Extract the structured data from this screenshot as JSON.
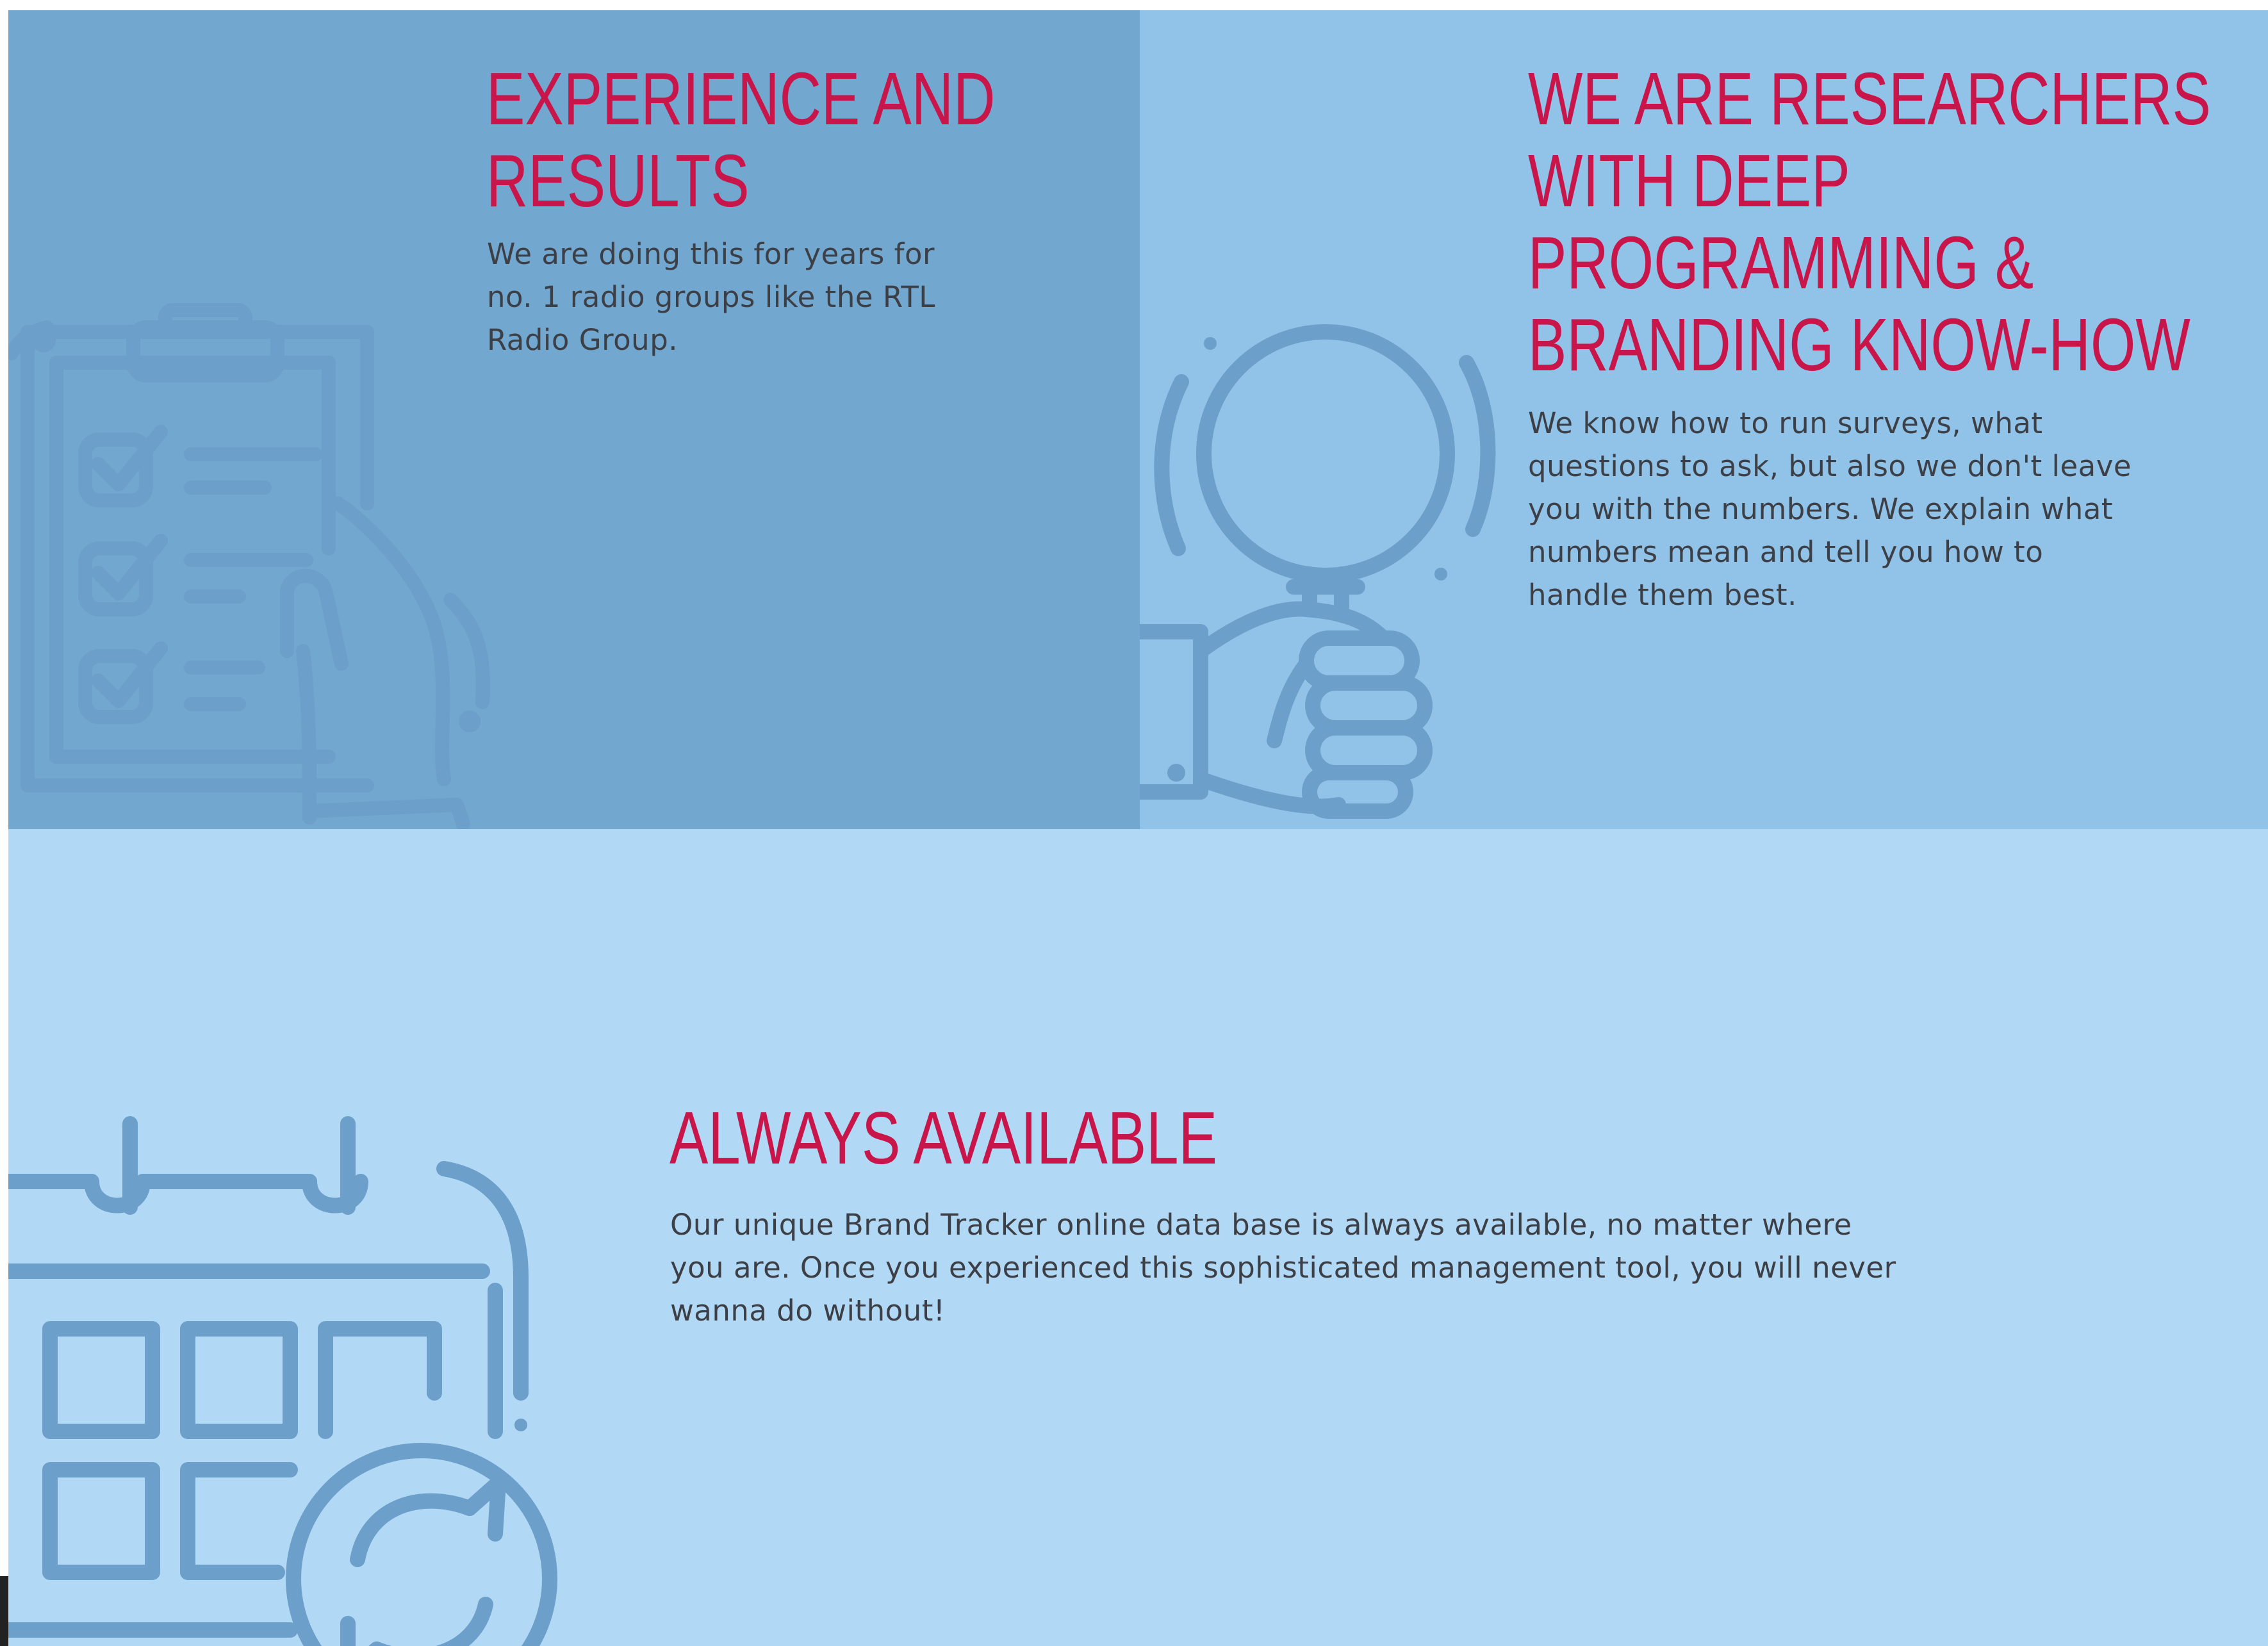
{
  "features": [
    {
      "title_lines": [
        "EXPERIENCE AND",
        "RESULTS"
      ],
      "body_lines": [
        "We are doing this for years for",
        "no. 1 radio groups like the RTL",
        "Radio Group."
      ],
      "icon": "clipboard-checklist-icon"
    },
    {
      "title_lines": [
        "WE ARE RESEARCHERS",
        "WITH DEEP",
        "PROGRAMMING &",
        "BRANDING KNOW-HOW"
      ],
      "body_lines": [
        "We know how to run surveys, what",
        "questions to ask, but also we don't leave",
        "you with the numbers. We explain what",
        "numbers mean and tell you how to",
        "handle them best."
      ],
      "icon": "magnifying-glass-hand-icon"
    },
    {
      "title_lines": [
        "ALWAYS AVAILABLE"
      ],
      "body_lines": [
        "Our unique Brand Tracker online data base is always available, no matter where",
        "you are. Once you experienced this sophisticated management tool, you will never",
        "wanna do without!"
      ],
      "icon": "calendar-refresh-icon"
    }
  ],
  "colors": {
    "heading": "#c8164b",
    "body_text": "#3c3f46",
    "panel_dark": "#72a7cf",
    "panel_mid": "#91c2e7",
    "panel_light": "#b1d8f4",
    "icon_stroke": "#6c9fc9"
  }
}
